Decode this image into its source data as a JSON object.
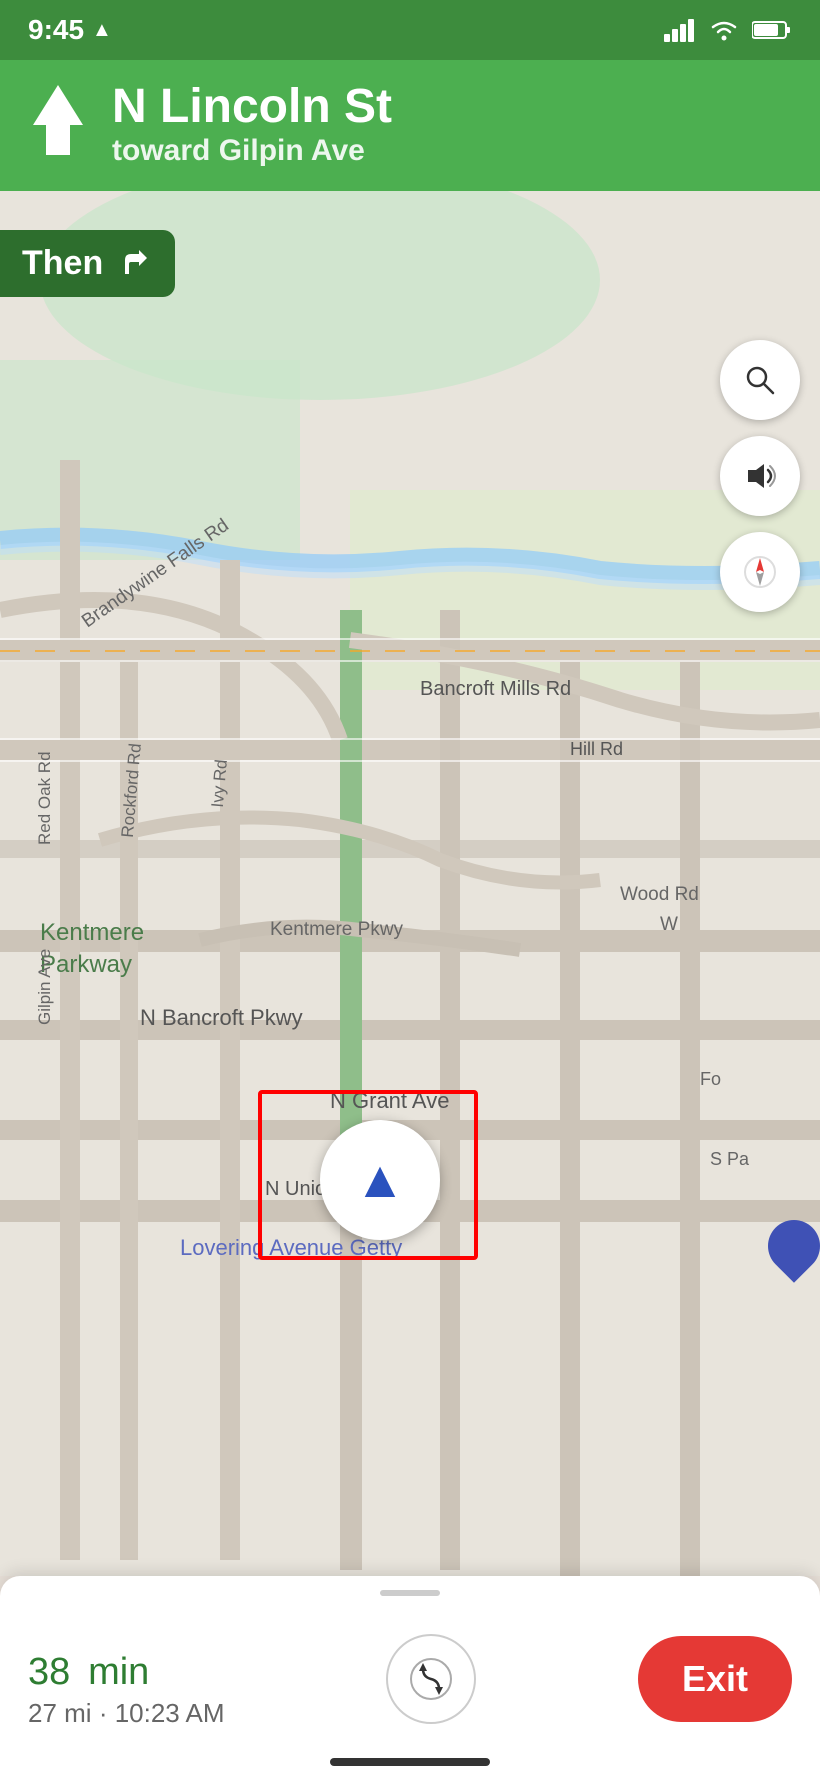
{
  "statusBar": {
    "time": "9:45",
    "locationIcon": "▲",
    "signalBars": "▌▌▌▌",
    "wifi": "wifi",
    "battery": "battery"
  },
  "navHeader": {
    "upArrow": "↑",
    "street": "N Lincoln St",
    "toward": "toward",
    "crossStreet": "Gilpin Ave"
  },
  "thenBanner": {
    "label": "Then",
    "arrowIcon": "↱"
  },
  "mapButtons": {
    "searchLabel": "🔍",
    "soundLabel": "🔊",
    "compassLabel": "🧭"
  },
  "mapLabels": {
    "brandywine": "Brandywine Falls Rd",
    "bancroft": "Bancroft Mills Rd",
    "hillRd": "Hill Rd",
    "rockford": "Rockford Rd",
    "ivyRd": "Ivy Rd",
    "kentmerePkwy": "Kentmere Parkway",
    "kentmerePkwyRoad": "Kentmere Pkwy",
    "woodRd": "Wood Rd",
    "nBancroftPkwy": "N Bancroft Pkwy",
    "nGrantAve": "N Grant Ave",
    "nUnionSt": "N Union St",
    "gilpinAve": "Gilpin Ave",
    "redOakRd": "Red Oak Rd",
    "loveringAve": "Lovering Avenue Getty",
    "sPa": "S Pa",
    "fo": "Fo",
    "w": "W"
  },
  "bottomPanel": {
    "etaMins": "38",
    "etaUnit": "min",
    "distance": "27 mi",
    "arrivalTime": "10:23 AM",
    "routesBtnIcon": "⇅",
    "exitLabel": "Exit"
  }
}
